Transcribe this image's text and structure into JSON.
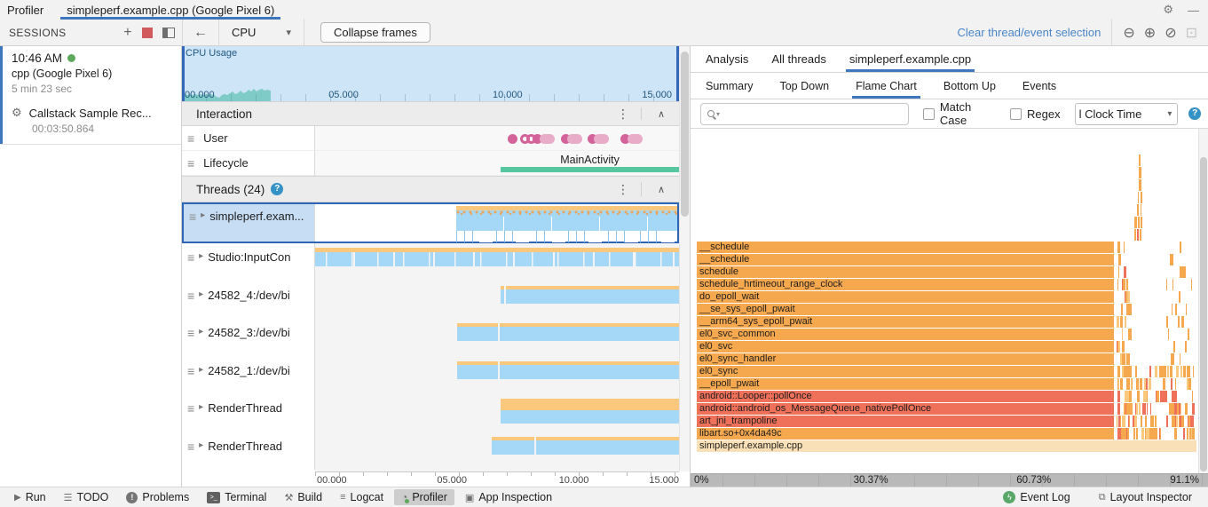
{
  "header": {
    "app_tab": "Profiler",
    "session_tab": "simpleperf.example.cpp (Google Pixel 6)"
  },
  "toolbar": {
    "sessions": "SESSIONS",
    "device": "CPU",
    "collapse_frames": "Collapse frames",
    "clear_selection": "Clear thread/event selection"
  },
  "session": {
    "time": "10:46 AM",
    "name": "cpp (Google Pixel 6)",
    "duration": "5 min 23 sec",
    "recording": "Callstack Sample Rec...",
    "recording_time": "00:03:50.864"
  },
  "timeline": {
    "cpu_label": "CPU Usage",
    "cpu_ticks": [
      "00.000",
      "05.000",
      "10.000",
      "15.000"
    ],
    "axis_ticks": [
      "00.000",
      "05.000",
      "10.000",
      "15.000"
    ],
    "interaction_title": "Interaction",
    "user_label": "User",
    "lifecycle_label": "Lifecycle",
    "main_activity": "MainActivity",
    "threads_title": "Threads (24)",
    "cpu_wave": [
      [
        0,
        7
      ],
      [
        3,
        8
      ],
      [
        6,
        7
      ],
      [
        9,
        8
      ],
      [
        12,
        7
      ],
      [
        15,
        8
      ],
      [
        18,
        7
      ],
      [
        21,
        8
      ],
      [
        24,
        7
      ],
      [
        27,
        8
      ],
      [
        30,
        7
      ],
      [
        33,
        8
      ],
      [
        36,
        7
      ],
      [
        39,
        5
      ],
      [
        42,
        4
      ],
      [
        45,
        7
      ],
      [
        48,
        8
      ],
      [
        51,
        7
      ],
      [
        54,
        9
      ],
      [
        57,
        11
      ],
      [
        60,
        8
      ],
      [
        63,
        9
      ],
      [
        66,
        12
      ],
      [
        69,
        9
      ],
      [
        72,
        10
      ],
      [
        75,
        13
      ],
      [
        78,
        11
      ],
      [
        81,
        14
      ],
      [
        84,
        11
      ],
      [
        87,
        13
      ],
      [
        90,
        14
      ],
      [
        93,
        12
      ],
      [
        96,
        13
      ],
      [
        100,
        12
      ]
    ],
    "user_events": [
      {
        "x": 53,
        "k": "dot"
      },
      {
        "x": 56.3,
        "k": "ring"
      },
      {
        "x": 58,
        "k": "ring"
      },
      {
        "x": 59.8,
        "k": "dot"
      },
      {
        "x": 61.6,
        "k": "tail"
      },
      {
        "x": 67.5,
        "k": "dot"
      },
      {
        "x": 69.3,
        "k": "tail"
      },
      {
        "x": 74.8,
        "k": "dot"
      },
      {
        "x": 76.6,
        "k": "tail"
      },
      {
        "x": 84,
        "k": "dot"
      },
      {
        "x": 85.8,
        "k": "tail"
      }
    ],
    "threads": [
      {
        "name": "simpleperf.exam...",
        "selected": true,
        "pattern": "speckle",
        "stripe": 5,
        "bar": 16,
        "ticks": true,
        "segments": [
          [
            39,
            100
          ]
        ]
      },
      {
        "name": "Studio:InputCon",
        "pattern": "dense",
        "stripe": 5,
        "bar": 16,
        "segments": [
          [
            0,
            100
          ]
        ]
      },
      {
        "name": "24582_4:/dev/bi",
        "stripe": 4,
        "bar": 16,
        "segments": [
          [
            51,
            52
          ],
          [
            52.5,
            100
          ]
        ]
      },
      {
        "name": "24582_3:/dev/bi",
        "stripe": 4,
        "bar": 16,
        "segments": [
          [
            39,
            50.2
          ],
          [
            50.8,
            100
          ]
        ]
      },
      {
        "name": "24582_1:/dev/bi",
        "stripe": 4,
        "bar": 16,
        "segments": [
          [
            39,
            50.2
          ],
          [
            50.8,
            100
          ]
        ]
      },
      {
        "name": "RenderThread",
        "stripe": 13,
        "bar": 15,
        "segments": [
          [
            51,
            100
          ]
        ]
      },
      {
        "name": "RenderThread",
        "stripe": 4,
        "bar": 16,
        "segments": [
          [
            48.5,
            60.2
          ],
          [
            60.7,
            100
          ]
        ]
      }
    ]
  },
  "analysis": {
    "tabs": [
      "Analysis",
      "All threads",
      "simpleperf.example.cpp"
    ],
    "active_tab": 2,
    "subtabs": [
      "Summary",
      "Top Down",
      "Flame Chart",
      "Bottom Up",
      "Events"
    ],
    "active_subtab": 2,
    "match_case": "Match Case",
    "regex": "Regex",
    "clock": "l Clock Time"
  },
  "chart_data": {
    "type": "flame",
    "title": "Flame Chart",
    "axis_labels": [
      "0%",
      "30.37%",
      "60.73%",
      "91.1%"
    ],
    "main_width_pct": 83.5,
    "rows": [
      {
        "label": "__schedule",
        "color": "o"
      },
      {
        "label": "__schedule",
        "color": "o"
      },
      {
        "label": "schedule",
        "color": "o"
      },
      {
        "label": "schedule_hrtimeout_range_clock",
        "color": "o"
      },
      {
        "label": "do_epoll_wait",
        "color": "o"
      },
      {
        "label": "__se_sys_epoll_pwait",
        "color": "o"
      },
      {
        "label": "__arm64_sys_epoll_pwait",
        "color": "o"
      },
      {
        "label": "el0_svc_common",
        "color": "o"
      },
      {
        "label": "el0_svc",
        "color": "o"
      },
      {
        "label": "el0_sync_handler",
        "color": "o"
      },
      {
        "label": "el0_sync",
        "color": "o"
      },
      {
        "label": "__epoll_pwait",
        "color": "o"
      },
      {
        "label": "android::Looper::pollOnce",
        "color": "r"
      },
      {
        "label": "android::android_os_MessageQueue_nativePollOnce",
        "color": "r"
      },
      {
        "label": "art_jni_trampoline",
        "color": "r"
      },
      {
        "label": "libart.so+0x4da49c",
        "color": "o"
      }
    ],
    "base": {
      "label": "simpleperf.example.cpp",
      "color": "base",
      "width_pct": 100
    },
    "palette": {
      "o": "#F6A84E",
      "r": "#F0715A",
      "l": "#FBC97D",
      "base": "#FAE0B6"
    },
    "spike": [
      {
        "lvl": 1,
        "x": 84.5,
        "w": 0.35,
        "c": "o"
      },
      {
        "lvl": 1,
        "x": 85.05,
        "w": 0.3,
        "c": "r"
      },
      {
        "lvl": 1,
        "x": 85.55,
        "w": 0.4,
        "c": "o"
      },
      {
        "lvl": 2,
        "x": 84.6,
        "w": 0.4,
        "c": "o"
      },
      {
        "lvl": 2,
        "x": 85.2,
        "w": 0.35,
        "c": "o"
      },
      {
        "lvl": 2,
        "x": 85.8,
        "w": 0.3,
        "c": "o"
      },
      {
        "lvl": 3,
        "x": 85.1,
        "w": 0.35,
        "c": "o"
      },
      {
        "lvl": 3,
        "x": 85.7,
        "w": 0.3,
        "c": "o"
      },
      {
        "lvl": 4,
        "x": 85.2,
        "w": 0.3,
        "c": "o"
      },
      {
        "lvl": 4,
        "x": 85.7,
        "w": 0.35,
        "c": "o"
      },
      {
        "lvl": 5,
        "x": 85.45,
        "w": 0.4,
        "c": "o"
      },
      {
        "lvl": 6,
        "x": 85.45,
        "w": 0.4,
        "c": "o"
      },
      {
        "lvl": 7,
        "x": 85.5,
        "w": 0.35,
        "c": "o"
      }
    ],
    "fragment_seed": 7
  },
  "statusbar": {
    "left": [
      {
        "label": "Run",
        "icon": "run"
      },
      {
        "label": "TODO",
        "icon": "todo"
      },
      {
        "label": "Problems",
        "icon": "problems"
      },
      {
        "label": "Terminal",
        "icon": "terminal"
      },
      {
        "label": "Build",
        "icon": "build"
      },
      {
        "label": "Logcat",
        "icon": "logcat"
      },
      {
        "label": "Profiler",
        "icon": "profiler",
        "active": true
      },
      {
        "label": "App Inspection",
        "icon": "app-inspection"
      }
    ],
    "right": [
      {
        "label": "Event Log",
        "icon": "event-log"
      },
      {
        "label": "Layout Inspector",
        "icon": "layout-inspector"
      }
    ]
  },
  "icons": {
    "gear": "⚙",
    "minimize": "—",
    "plus": "+",
    "back-arrow": "←",
    "caret-down": "▾",
    "kebab": "⋮",
    "chevron-up": "∧",
    "expander": "▸",
    "hamburger": "≡",
    "zoom-out": "⊖",
    "zoom-in": "⊕",
    "reset-zoom": "⊘",
    "zoom-selection": "⊡",
    "help": "?",
    "run": "▶",
    "todo": "☰",
    "problems": "!",
    "terminal": ">_",
    "build": "⚒",
    "logcat": "≡",
    "profiler": "◔",
    "app-inspection": "▣",
    "event-log": "ϟ",
    "layout-inspector": "⧉"
  }
}
